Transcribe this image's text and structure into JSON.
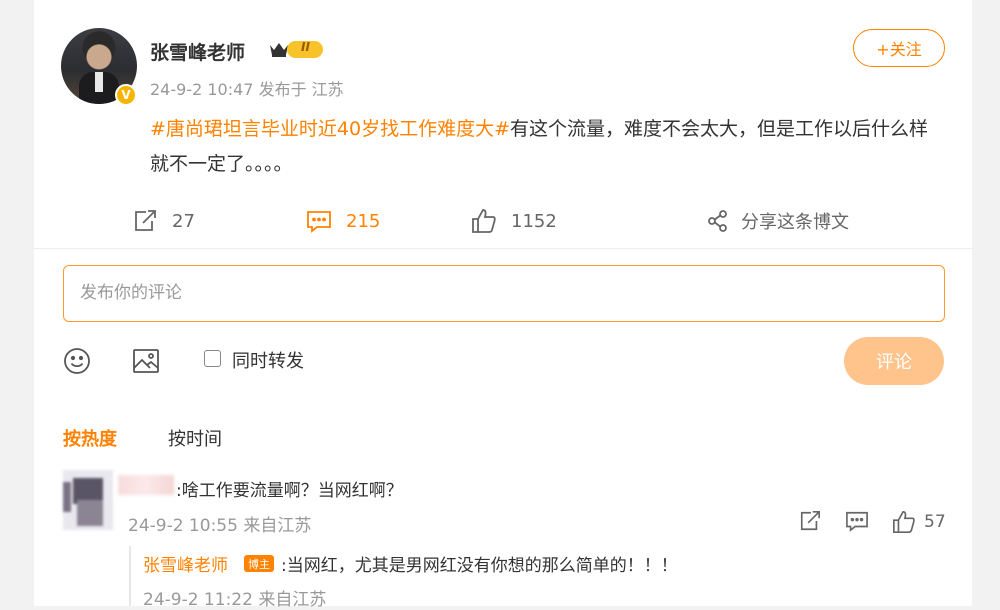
{
  "post": {
    "author": "张雪峰老师",
    "rank_badge": "II",
    "verified_badge": "V",
    "timestamp": "24-9-2 10:47",
    "source": "发布于 江苏",
    "follow_label": "+关注",
    "topic": "#唐尚珺坦言毕业时近40岁找工作难度大#",
    "text": "有这个流量，难度不会太大，但是工作以后什么样就不一定了。。。。",
    "repost_count": "27",
    "comment_count": "215",
    "like_count": "1152",
    "share_label": "分享这条博文"
  },
  "composer": {
    "placeholder": "发布你的评论",
    "repost_label": "同时转发",
    "submit_label": "评论"
  },
  "sort": {
    "hot_label": "按热度",
    "time_label": "按时间"
  },
  "comments": [
    {
      "text": ":啥工作要流量啊？当网红啊？",
      "timestamp": "24-9-2 10:55",
      "source": "来自江苏",
      "like_count": "57",
      "reply": {
        "author": "张雪峰老师",
        "tag": "博主",
        "text": ":当网红，尤其是男网红没有你想的那么简单的！！！",
        "timestamp": "24-9-2 11:22",
        "source": "来自江苏"
      }
    }
  ],
  "colors": {
    "accent": "#ff8200",
    "muted": "#999999",
    "submit_disabled": "#ffc38c"
  }
}
